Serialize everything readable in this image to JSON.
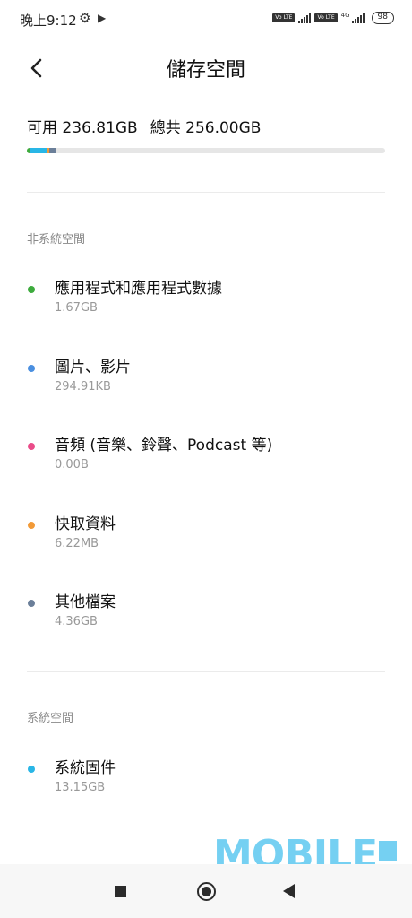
{
  "status_bar": {
    "time": "晚上9:12",
    "gear_icon": "gear-icon",
    "play_icon": "play-store-icon",
    "volte_label": "Vo LTE",
    "network": "4G",
    "battery": "98"
  },
  "header": {
    "back_icon": "chevron-left-icon",
    "title": "儲存空間"
  },
  "summary": {
    "available": "可用 236.81GB",
    "total": "總共 256.00GB"
  },
  "usage_bar": [
    {
      "category": "應用程式和應用程式數據",
      "color": "#3dab3d",
      "fraction": 0.007
    },
    {
      "category": "系統固件",
      "color": "#29b6e6",
      "fraction": 0.051
    },
    {
      "category": "快取資料",
      "color": "#f29a38",
      "fraction": 0.004
    },
    {
      "category": "其他檔案",
      "color": "#6b7f99",
      "fraction": 0.017
    }
  ],
  "non_system_section": {
    "label": "非系統空間",
    "items": [
      {
        "label": "應用程式和應用程式數據",
        "size": "1.67GB",
        "color": "#3dab3d"
      },
      {
        "label": "圖片、影片",
        "size": "294.91KB",
        "color": "#4a8fe0"
      },
      {
        "label": "音頻 (音樂、鈴聲、Podcast 等)",
        "size": "0.00B",
        "color": "#ea4c89"
      },
      {
        "label": "快取資料",
        "size": "6.22MB",
        "color": "#f29a38"
      },
      {
        "label": "其他檔案",
        "size": "4.36GB",
        "color": "#6b7f99"
      }
    ]
  },
  "system_section": {
    "label": "系統空間",
    "items": [
      {
        "label": "系統固件",
        "size": "13.15GB",
        "color": "#29b6e6"
      }
    ]
  },
  "watermark": "MOBILE",
  "nav": {
    "recents_icon": "square-icon",
    "home_icon": "home-circle-icon",
    "back_icon": "triangle-back-icon"
  }
}
